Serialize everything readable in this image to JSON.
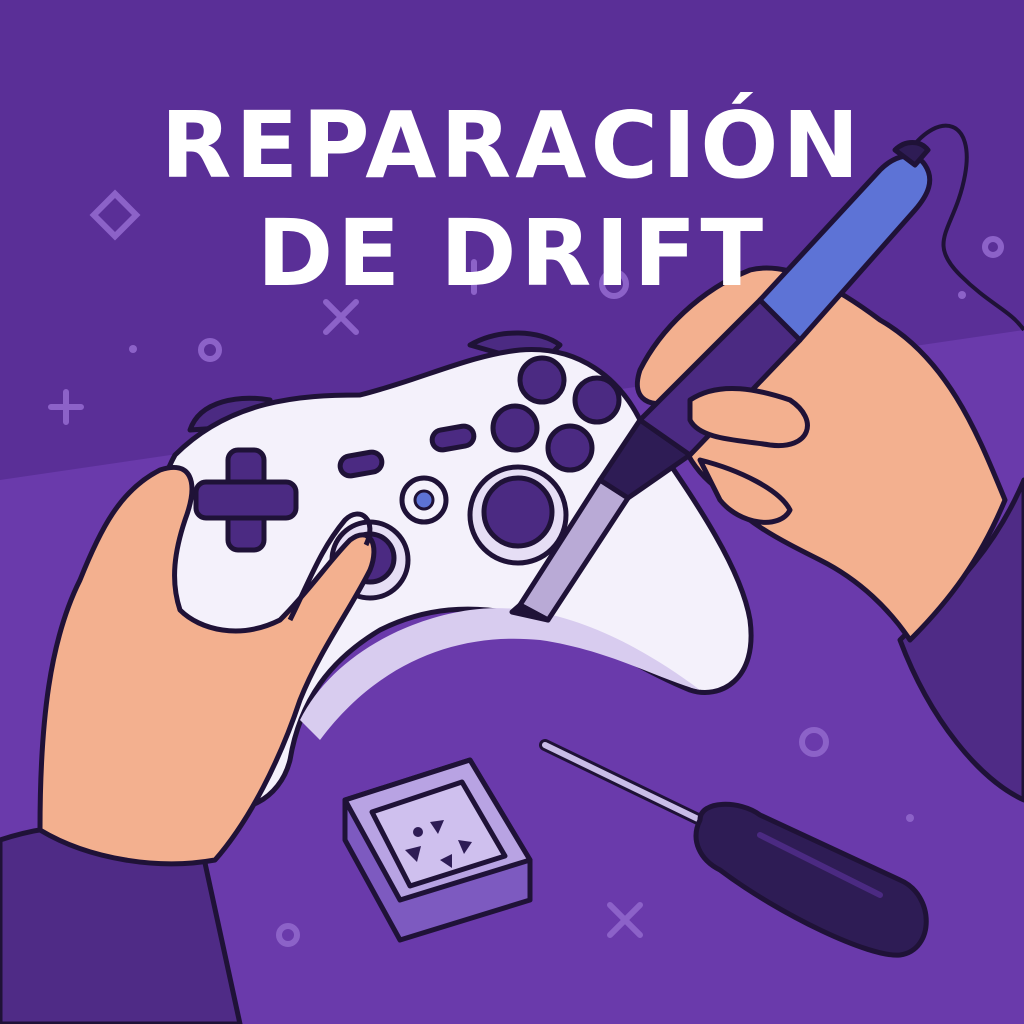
{
  "title": {
    "line1": "REPARACIÓN",
    "line2": "DE DRIFT"
  },
  "colors": {
    "background": "#5a2f97",
    "table": "#6a3aab",
    "controller": "#f4f1fb",
    "controller_shade": "#d8ccef",
    "buttons": "#4b2a82",
    "skin": "#f3b08f",
    "sleeve": "#4f2b86",
    "solder_iron": "#5d73d6",
    "outline": "#1f1237",
    "title": "#ffffff"
  },
  "icons": [
    "soldering-iron-icon",
    "screwdriver-icon",
    "screw-tray-icon",
    "game-controller-icon"
  ]
}
